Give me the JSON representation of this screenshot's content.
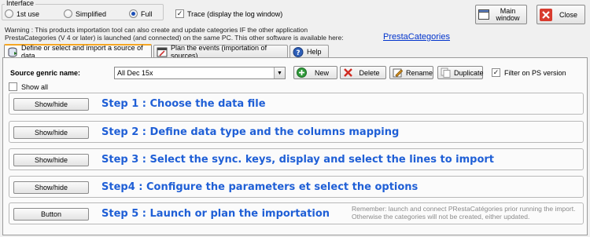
{
  "interface": {
    "legend": "Interface",
    "options": [
      {
        "label": "1st use",
        "checked": false
      },
      {
        "label": "Simplified",
        "checked": false
      },
      {
        "label": "Full",
        "checked": true
      }
    ],
    "trace_label": "Trace (display the log window)",
    "trace_checked": true
  },
  "window_buttons": {
    "main_window": "Main window",
    "close": "Close"
  },
  "warning": {
    "text": "Warning : This products importation tool can also create and update categories IF the other application PrestaCategories (V 4 or later) is launched (and connected) on the same PC. This other software is available here:",
    "link": "PrestaCategories"
  },
  "tabs": [
    {
      "label": "Define or select and import a source of data",
      "active": true,
      "icon": "database-import-icon"
    },
    {
      "label": "Plan the events (importation of sources)",
      "active": false,
      "icon": "calendar-plan-icon"
    },
    {
      "label": "Help",
      "active": false,
      "icon": "help-icon"
    }
  ],
  "source": {
    "label": "Source genric name:",
    "selected": "All Dec 15x",
    "show_all_label": "Show all",
    "filter_label": "Filter on PS version",
    "filter_checked": true
  },
  "toolbar": {
    "new": "New",
    "delete": "Delete",
    "rename": "Rename",
    "duplicate": "Duplicate"
  },
  "steps": [
    {
      "button": "Show/hide",
      "title": "Step 1 : Choose the data file"
    },
    {
      "button": "Show/hide",
      "title": "Step 2 : Define data type and the columns mapping"
    },
    {
      "button": "Show/hide",
      "title": "Step 3 : Select the sync. keys, display and select the lines to import"
    },
    {
      "button": "Show/hide",
      "title": "Step4 : Configure the parameters et select the options"
    },
    {
      "button": "Button",
      "title": "Step 5 : Launch or plan the importation",
      "note": "Remember: launch and connect PRestaCatégories prior running the import. Otherwise the categories will not be created, either updated."
    }
  ],
  "colors": {
    "step_title": "#1f5fd6",
    "link": "#0033cc",
    "active_tab_accent": "#f5a623"
  }
}
